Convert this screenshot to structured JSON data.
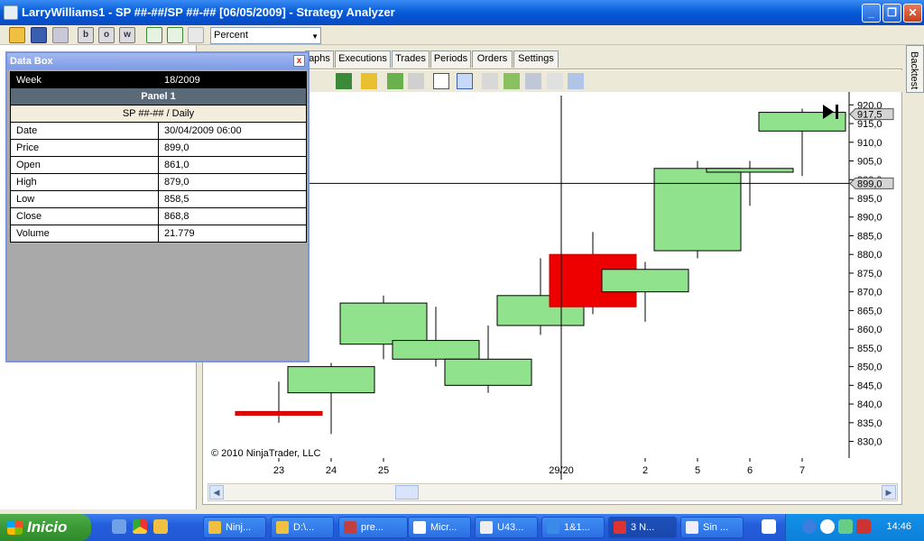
{
  "window": {
    "title": "LarryWilliams1 - SP ##-##/SP ##-## [06/05/2009] - Strategy Analyzer",
    "minimize": "_",
    "maximize": "❐",
    "close": "✕"
  },
  "toolbar": {
    "b_label": "b",
    "o_label": "o",
    "w_label": "w",
    "view_select": "Percent"
  },
  "tabs": [
    "aphs",
    "Executions",
    "Trades",
    "Periods",
    "Orders",
    "Settings"
  ],
  "right_tab": "Backtest",
  "data_box": {
    "title": "Data Box",
    "close": "x",
    "week_label": "Week",
    "week_value": "18/2009",
    "panel_label": "Panel 1",
    "series_label": "SP ##-## / Daily",
    "rows": [
      {
        "label": "Date",
        "value": "30/04/2009 06:00"
      },
      {
        "label": "Price",
        "value": "899,0"
      },
      {
        "label": "Open",
        "value": "861,0"
      },
      {
        "label": "High",
        "value": "879,0"
      },
      {
        "label": "Low",
        "value": "858,5"
      },
      {
        "label": "Close",
        "value": "868,8"
      },
      {
        "label": "Volume",
        "value": "21.779"
      }
    ]
  },
  "chart_data": {
    "type": "candlestick",
    "ylim": [
      827,
      922
    ],
    "y_ticks": [
      "920,0",
      "915,0",
      "910,0",
      "905,0",
      "900,0",
      "895,0",
      "890,0",
      "885,0",
      "880,0",
      "875,0",
      "870,0",
      "865,0",
      "860,0",
      "855,0",
      "850,0",
      "845,0",
      "840,0",
      "835,0",
      "830,0"
    ],
    "x_ticks": [
      "23",
      "24",
      "25",
      "29/20",
      "2",
      "5",
      "6",
      "7"
    ],
    "last_price_label": "917,5",
    "crosshair_price_label": "899,0",
    "crosshair_price": 899.0,
    "copyright": "© 2010 NinjaTrader, LLC",
    "bars": [
      {
        "open": 838.0,
        "close": 837.0,
        "high": 846.0,
        "low": 835.0,
        "color": "#ee0000"
      },
      {
        "open": 843.0,
        "close": 850.0,
        "high": 851.0,
        "low": 832.0,
        "color": "#90e28c"
      },
      {
        "open": 856.0,
        "close": 867.0,
        "high": 869.0,
        "low": 852.0,
        "color": "#90e28c"
      },
      {
        "open": 852.0,
        "close": 857.0,
        "high": 866.0,
        "low": 850.0,
        "color": "#90e28c"
      },
      {
        "open": 845.0,
        "close": 852.0,
        "high": 861.0,
        "low": 843.0,
        "color": "#90e28c"
      },
      {
        "open": 861.0,
        "close": 869.0,
        "high": 879.0,
        "low": 858.5,
        "color": "#90e28c"
      },
      {
        "open": 880.0,
        "close": 866.0,
        "high": 886.0,
        "low": 864.0,
        "color": "#ee0000"
      },
      {
        "open": 870.0,
        "close": 876.0,
        "high": 878.0,
        "low": 862.0,
        "color": "#90e28c"
      },
      {
        "open": 881.0,
        "close": 903.0,
        "high": 905.0,
        "low": 879.0,
        "color": "#90e28c"
      },
      {
        "open": 902.0,
        "close": 903.0,
        "high": 905.0,
        "low": 893.0,
        "color": "#90e28c"
      },
      {
        "open": 913.0,
        "close": 918.0,
        "high": 919.0,
        "low": 901.0,
        "color": "#90e28c"
      }
    ]
  },
  "taskbar": {
    "start_label": "Inicio",
    "tasks": [
      "Ninj...",
      "D:\\...",
      "pre...",
      "Micr...",
      "U43...",
      "1&1...",
      "3 N...",
      "Sin ..."
    ],
    "clock": "14:46"
  }
}
